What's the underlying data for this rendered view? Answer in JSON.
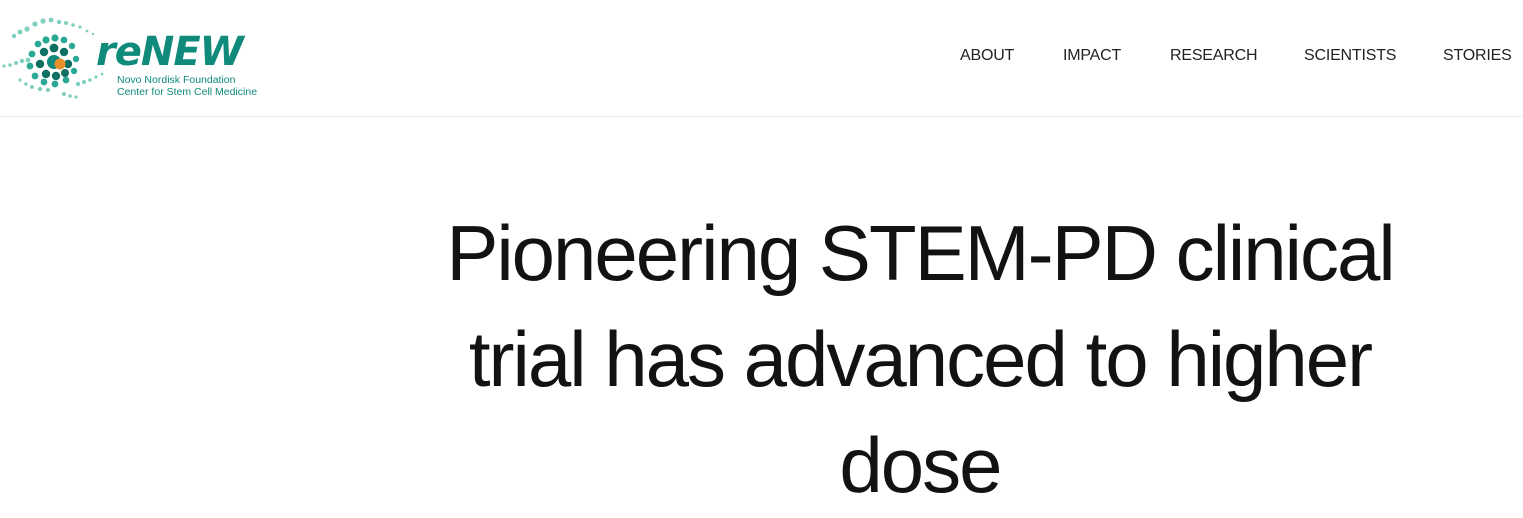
{
  "brand": {
    "name": "reNEW",
    "subtitle_line1": "Novo Nordisk Foundation",
    "subtitle_line2": "Center for Stem Cell Medicine",
    "primary_color": "#0f8a7b",
    "accent_color": "#e8912a",
    "light_color": "#7fd0c0"
  },
  "nav": {
    "items": [
      {
        "label": "ABOUT"
      },
      {
        "label": "IMPACT"
      },
      {
        "label": "RESEARCH"
      },
      {
        "label": "SCIENTISTS"
      },
      {
        "label": "STORIES"
      }
    ]
  },
  "article": {
    "title_line1": "Pioneering STEM-PD clinical",
    "title_line2": "trial has advanced to higher",
    "title_line3": "dose"
  }
}
